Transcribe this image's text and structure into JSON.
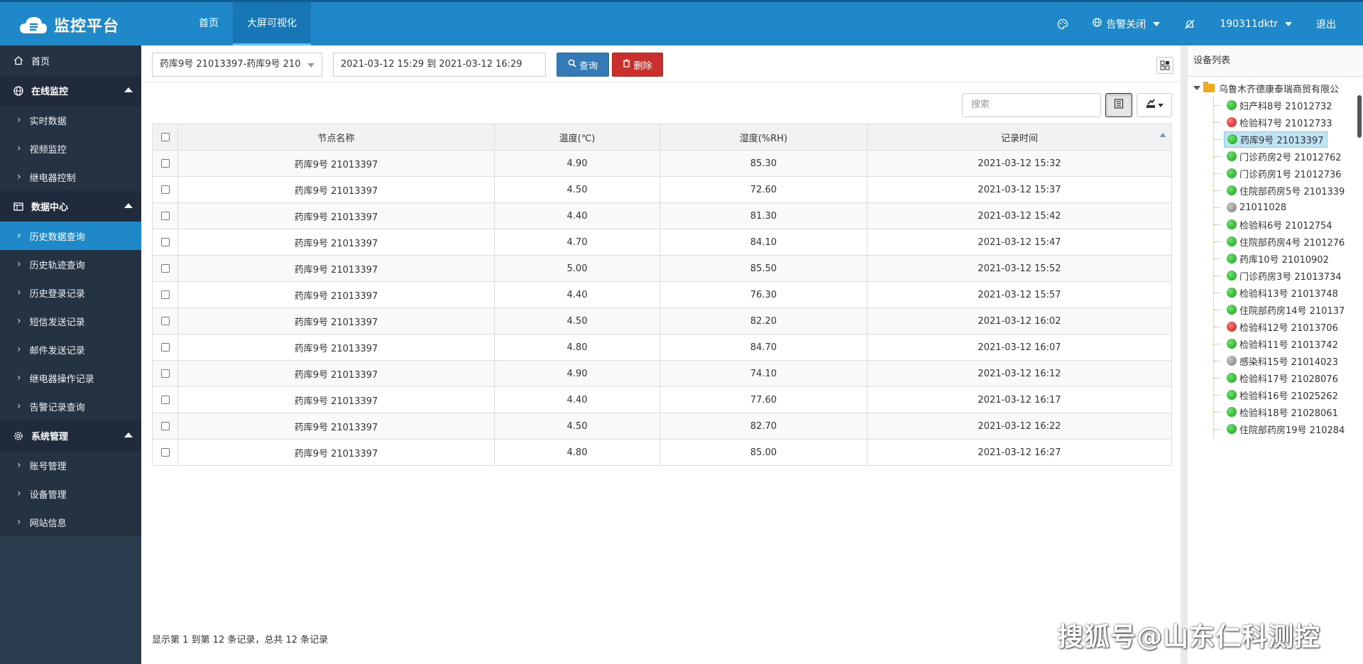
{
  "app": {
    "title": "监控平台"
  },
  "topnav": {
    "items": [
      {
        "label": "首页"
      },
      {
        "label": "大屏可视化"
      }
    ]
  },
  "topright": {
    "alarm_label": "告警关闭",
    "user_label": "190311dktr",
    "logout_label": "退出"
  },
  "sidebar": {
    "home": "首页",
    "groups": [
      {
        "label": "在线监控",
        "items": [
          "实时数据",
          "视频监控",
          "继电器控制"
        ]
      },
      {
        "label": "数据中心",
        "items": [
          "历史数据查询",
          "历史轨迹查询",
          "历史登录记录",
          "短信发送记录",
          "邮件发送记录",
          "继电器操作记录",
          "告警记录查询"
        ]
      },
      {
        "label": "系统管理",
        "items": [
          "账号管理",
          "设备管理",
          "网站信息"
        ]
      }
    ],
    "active_item": "历史数据查询"
  },
  "toolbar": {
    "node_select": "药库9号 21013397-药库9号 210",
    "date_range": "2021-03-12 15:29 到 2021-03-12 16:29",
    "query_label": "查询",
    "delete_label": "删除"
  },
  "table_tools": {
    "search_placeholder": "搜索"
  },
  "table": {
    "headers": [
      "节点名称",
      "温度(℃)",
      "湿度(%RH)",
      "记录时间"
    ],
    "rows": [
      {
        "node": "药库9号 21013397",
        "temp": "4.90",
        "hum": "85.30",
        "time": "2021-03-12 15:32"
      },
      {
        "node": "药库9号 21013397",
        "temp": "4.50",
        "hum": "72.60",
        "time": "2021-03-12 15:37"
      },
      {
        "node": "药库9号 21013397",
        "temp": "4.40",
        "hum": "81.30",
        "time": "2021-03-12 15:42"
      },
      {
        "node": "药库9号 21013397",
        "temp": "4.70",
        "hum": "84.10",
        "time": "2021-03-12 15:47"
      },
      {
        "node": "药库9号 21013397",
        "temp": "5.00",
        "hum": "85.50",
        "time": "2021-03-12 15:52"
      },
      {
        "node": "药库9号 21013397",
        "temp": "4.40",
        "hum": "76.30",
        "time": "2021-03-12 15:57"
      },
      {
        "node": "药库9号 21013397",
        "temp": "4.50",
        "hum": "82.20",
        "time": "2021-03-12 16:02"
      },
      {
        "node": "药库9号 21013397",
        "temp": "4.80",
        "hum": "84.70",
        "time": "2021-03-12 16:07"
      },
      {
        "node": "药库9号 21013397",
        "temp": "4.90",
        "hum": "74.10",
        "time": "2021-03-12 16:12"
      },
      {
        "node": "药库9号 21013397",
        "temp": "4.40",
        "hum": "77.60",
        "time": "2021-03-12 16:17"
      },
      {
        "node": "药库9号 21013397",
        "temp": "4.50",
        "hum": "82.70",
        "time": "2021-03-12 16:22"
      },
      {
        "node": "药库9号 21013397",
        "temp": "4.80",
        "hum": "85.00",
        "time": "2021-03-12 16:27"
      }
    ]
  },
  "footer": {
    "info": "显示第 1 到第 12 条记录，总共 12 条记录"
  },
  "device_panel": {
    "title": "设备列表",
    "root": "乌鲁木齐德康泰瑞商贸有限公",
    "selected": "药库9号 21013397",
    "devices": [
      {
        "label": "妇产科8号 21012732",
        "status": "green"
      },
      {
        "label": "检验科7号 21012733",
        "status": "red"
      },
      {
        "label": "药库9号 21013397",
        "status": "green"
      },
      {
        "label": "门诊药房2号 21012762",
        "status": "green"
      },
      {
        "label": "门诊药房1号 21012736",
        "status": "green"
      },
      {
        "label": "住院部药房5号 2101339",
        "status": "green"
      },
      {
        "label": "21011028",
        "status": "gray"
      },
      {
        "label": "检验科6号 21012754",
        "status": "green"
      },
      {
        "label": "住院部药房4号 2101276",
        "status": "green"
      },
      {
        "label": "药库10号 21010902",
        "status": "green"
      },
      {
        "label": "门诊药房3号 21013734",
        "status": "green"
      },
      {
        "label": "检验科13号 21013748",
        "status": "green"
      },
      {
        "label": "住院部药房14号 210137",
        "status": "green"
      },
      {
        "label": "检验科12号 21013706",
        "status": "red"
      },
      {
        "label": "检验科11号 21013742",
        "status": "green"
      },
      {
        "label": "感染科15号 21014023",
        "status": "gray"
      },
      {
        "label": "检验科17号 21028076",
        "status": "green"
      },
      {
        "label": "检验科16号 21025262",
        "status": "green"
      },
      {
        "label": "检验科18号 21028061",
        "status": "green"
      },
      {
        "label": "住院部药房19号 210284",
        "status": "green"
      }
    ]
  },
  "watermark": "搜狐号@山东仁科测控",
  "colors": {
    "topbar": "#1e88c9",
    "sidebar": "#2b3b4e",
    "active": "#1e88c9",
    "query": "#337ab7",
    "delete": "#c9302c"
  }
}
